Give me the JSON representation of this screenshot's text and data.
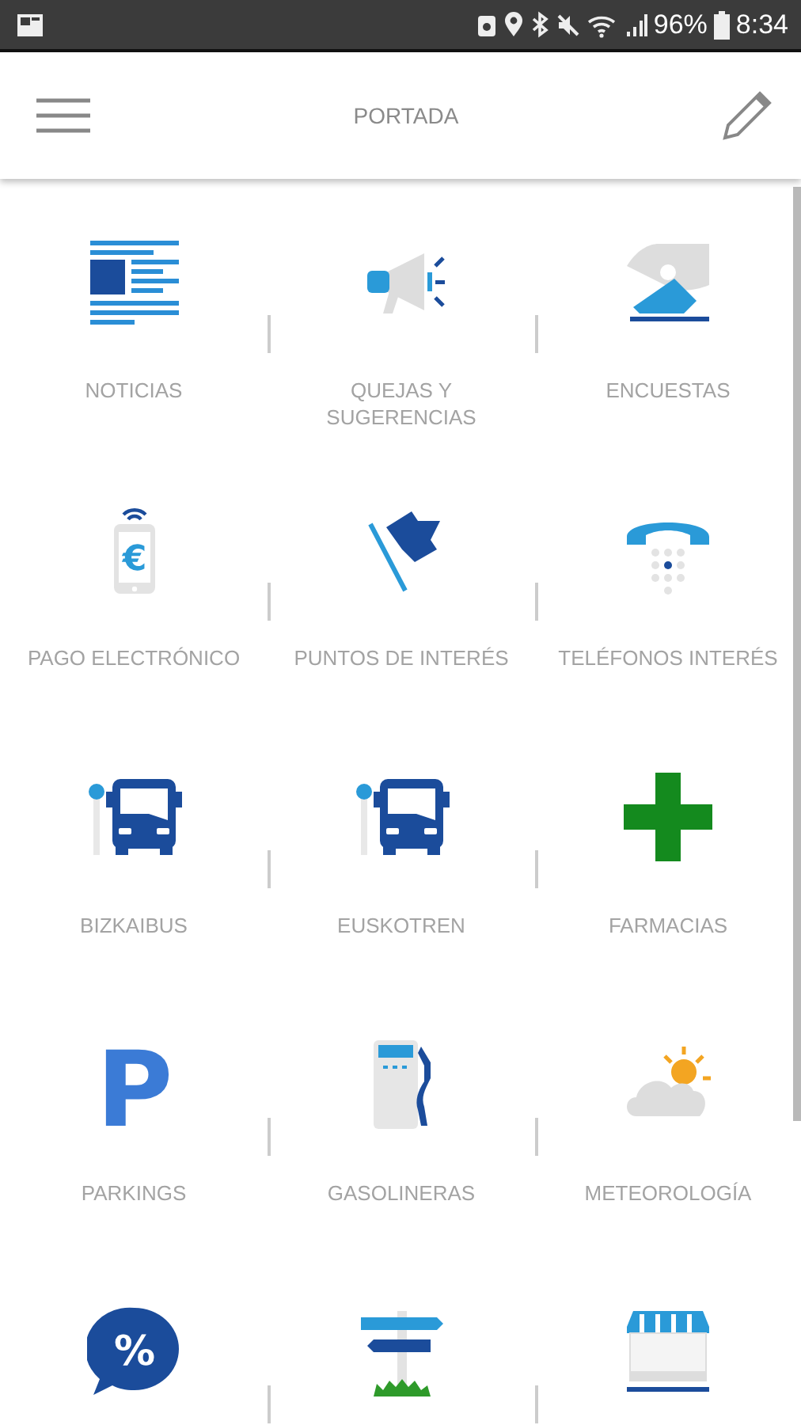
{
  "status_bar": {
    "battery_text": "96%",
    "time": "8:34"
  },
  "app_bar": {
    "title": "PORTADA"
  },
  "tiles": [
    {
      "kind": "news",
      "label": "NOTICIAS"
    },
    {
      "kind": "megaphone",
      "label": "QUEJAS Y SUGERENCIAS"
    },
    {
      "kind": "ballot",
      "label": "ENCUESTAS"
    },
    {
      "kind": "payment",
      "label": "PAGO ELECTRÓNICO",
      "glyph": "€"
    },
    {
      "kind": "flag",
      "label": "PUNTOS DE INTERÉS"
    },
    {
      "kind": "telephone",
      "label": "TELÉFONOS INTERÉS"
    },
    {
      "kind": "bus",
      "label": "BIZKAIBUS"
    },
    {
      "kind": "bus",
      "label": "EUSKOTREN"
    },
    {
      "kind": "cross",
      "label": "FARMACIAS"
    },
    {
      "kind": "parking",
      "label": "PARKINGS",
      "glyph": "P"
    },
    {
      "kind": "fuel",
      "label": "GASOLINERAS"
    },
    {
      "kind": "weather",
      "label": "METEOROLOGÍA"
    },
    {
      "kind": "discount",
      "glyph": "%"
    },
    {
      "kind": "signpost"
    },
    {
      "kind": "shop"
    }
  ]
}
